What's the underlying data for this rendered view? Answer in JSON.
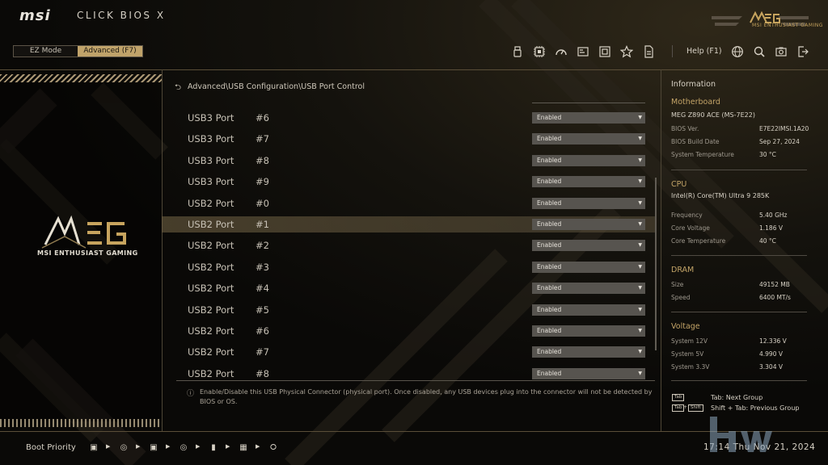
{
  "header": {
    "brand": "msi",
    "product": "CLICK BIOS X",
    "logo_text": "MEG",
    "logo_caption": "MSI ENTHUSIAST GAMING"
  },
  "mode_tabs": [
    {
      "label": "EZ Mode",
      "active": false
    },
    {
      "label": "Advanced (F7)",
      "active": true
    }
  ],
  "toolbar": {
    "icons": [
      "usb-drive-icon",
      "cpu-icon",
      "speedometer-icon",
      "board-explorer-icon",
      "memory-icon",
      "favorite-star-icon",
      "hardware-monitor-icon"
    ],
    "help_label": "Help (F1)",
    "right_icons": [
      "language-globe-icon",
      "search-icon",
      "screenshot-camera-icon",
      "exit-icon"
    ]
  },
  "left_panel": {
    "emblem_text": "MEG",
    "caption": "MSI ENTHUSIAST GAMING"
  },
  "breadcrumb": "Advanced\\USB Configuration\\USB Port Control",
  "ports": [
    {
      "type": "USB3 Port",
      "num": "#6",
      "value": "Enabled"
    },
    {
      "type": "USB3 Port",
      "num": "#7",
      "value": "Enabled"
    },
    {
      "type": "USB3 Port",
      "num": "#8",
      "value": "Enabled"
    },
    {
      "type": "USB3 Port",
      "num": "#9",
      "value": "Enabled"
    },
    {
      "type": "USB2 Port",
      "num": "#0",
      "value": "Enabled"
    },
    {
      "type": "USB2 Port",
      "num": "#1",
      "value": "Enabled",
      "selected": true
    },
    {
      "type": "USB2 Port",
      "num": "#2",
      "value": "Enabled"
    },
    {
      "type": "USB2 Port",
      "num": "#3",
      "value": "Enabled"
    },
    {
      "type": "USB2 Port",
      "num": "#4",
      "value": "Enabled"
    },
    {
      "type": "USB2 Port",
      "num": "#5",
      "value": "Enabled"
    },
    {
      "type": "USB2 Port",
      "num": "#6",
      "value": "Enabled"
    },
    {
      "type": "USB2 Port",
      "num": "#7",
      "value": "Enabled"
    },
    {
      "type": "USB2 Port",
      "num": "#8",
      "value": "Enabled"
    }
  ],
  "help_text": "Enable/Disable this USB Physical Connector (physical port).  Once disabled, any USB devices plug into the connector will not be detected by BIOS or OS.",
  "info": {
    "title": "Information",
    "motherboard": {
      "heading": "Motherboard",
      "model": "MEG Z890 ACE (MS-7E22)",
      "rows": [
        {
          "key": "BIOS Ver.",
          "val": "E7E22IMSI.1A20"
        },
        {
          "key": "BIOS Build Date",
          "val": "Sep 27, 2024"
        },
        {
          "key": "System Temperature",
          "val": "30 °C"
        }
      ]
    },
    "cpu": {
      "heading": "CPU",
      "model": "Intel(R) Core(TM) Ultra 9 285K",
      "rows": [
        {
          "key": "Frequency",
          "val": "5.40 GHz"
        },
        {
          "key": "Core Voltage",
          "val": "1.186 V"
        },
        {
          "key": "Core Temperature",
          "val": "40 °C"
        }
      ]
    },
    "dram": {
      "heading": "DRAM",
      "rows": [
        {
          "key": "Size",
          "val": "49152 MB"
        },
        {
          "key": "Speed",
          "val": "6400 MT/s"
        }
      ]
    },
    "voltage": {
      "heading": "Voltage",
      "rows": [
        {
          "key": "System 12V",
          "val": "12.336 V"
        },
        {
          "key": "System 5V",
          "val": "4.990 V"
        },
        {
          "key": "System 3.3V",
          "val": "3.304 V"
        }
      ]
    },
    "keys": [
      {
        "badges": [
          "Tab"
        ],
        "text": "Tab: Next Group"
      },
      {
        "badges": [
          "Tab",
          "Shift"
        ],
        "text": "Shift + Tab: Previous Group"
      }
    ]
  },
  "footer": {
    "boot_label": "Boot Priority",
    "boot_devices": [
      "hdd-icon",
      "optical-disc-icon",
      "hdd-icon",
      "optical-disc-icon",
      "usb-drive-icon",
      "network-icon",
      "usb-key-icon"
    ],
    "clock": "17:14  Thu Nov 21, 2024"
  },
  "colors": {
    "accent_gold": "#c0a36a",
    "panel_bg": "#0b0a08",
    "select_bg": "#57544f"
  }
}
